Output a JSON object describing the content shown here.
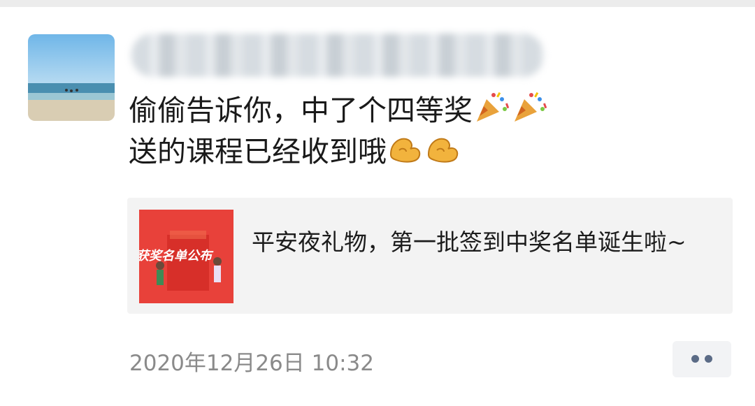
{
  "post": {
    "message_line1": "偷偷告诉你，中了个四等奖",
    "message_line2": "送的课程已经收到哦",
    "line1_emojis": [
      "party-popper-icon",
      "party-popper-icon"
    ],
    "line2_emojis": [
      "muscle-icon",
      "muscle-icon"
    ]
  },
  "link_card": {
    "title": "平安夜礼物，第一批签到中奖名单诞生啦~",
    "thumbnail_text": "获奖名单公布"
  },
  "footer": {
    "timestamp": "2020年12月26日 10:32"
  },
  "colors": {
    "card_background": "#f3f3f3",
    "thumbnail_red": "#e8413a",
    "timestamp_gray": "#8a8a8a",
    "more_dots": "#5b6b86"
  }
}
